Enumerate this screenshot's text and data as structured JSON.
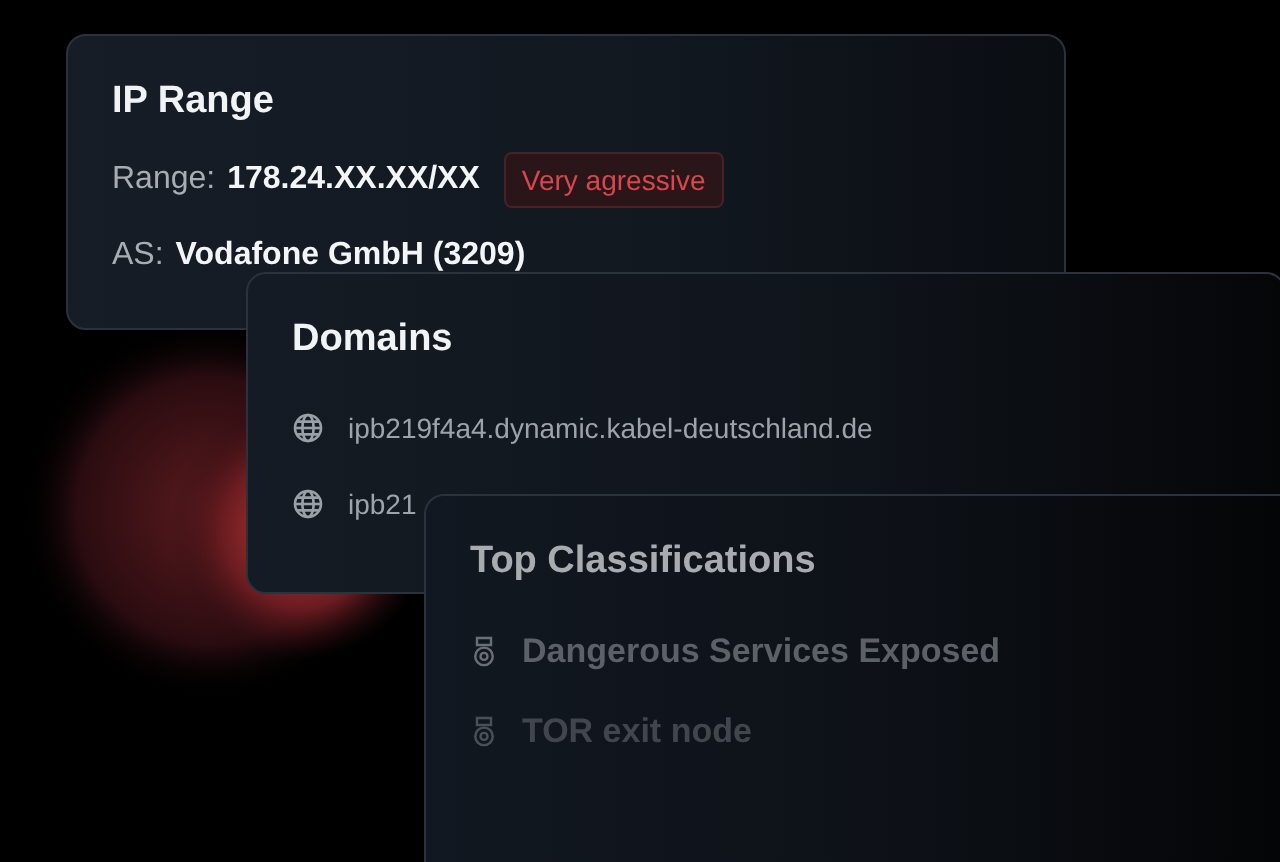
{
  "ip_range": {
    "title": "IP Range",
    "range_label": "Range:",
    "range_value": "178.24.XX.XX/XX",
    "badge": "Very agressive",
    "as_label": "AS:",
    "as_value": "Vodafone GmbH (3209)"
  },
  "domains": {
    "title": "Domains",
    "items": [
      {
        "text": "ipb219f4a4.dynamic.kabel-deutschland.de"
      },
      {
        "text": "ipb21"
      }
    ]
  },
  "classifications": {
    "title": "Top Classifications",
    "items": [
      {
        "text": "Dangerous Services Exposed"
      },
      {
        "text": "TOR exit node"
      }
    ]
  }
}
